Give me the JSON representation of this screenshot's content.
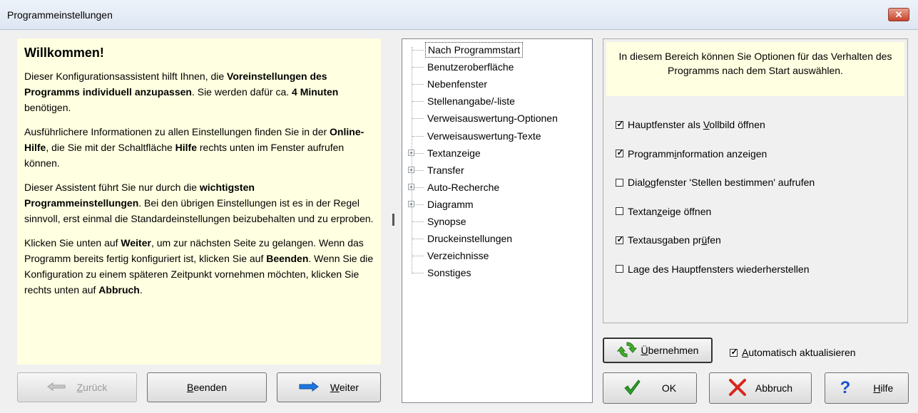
{
  "window": {
    "title": "Programmeinstellungen",
    "close_label": "✕"
  },
  "welcome": {
    "heading": "Willkommen!",
    "p1": [
      {
        "text": "Dieser Konfigurationsassistent hilft Ihnen, die ",
        "bold": false
      },
      {
        "text": "Voreinstellungen des Programms individuell anzupassen",
        "bold": true
      },
      {
        "text": ". Sie werden dafür ca. ",
        "bold": false
      },
      {
        "text": "4 Minuten",
        "bold": true
      },
      {
        "text": " benötigen.",
        "bold": false
      }
    ],
    "p2": [
      {
        "text": "Ausführlichere Informationen zu allen Einstellungen finden Sie in der ",
        "bold": false
      },
      {
        "text": "Online-Hilfe",
        "bold": true
      },
      {
        "text": ", die Sie mit der Schaltfläche ",
        "bold": false
      },
      {
        "text": "Hilfe",
        "bold": true
      },
      {
        "text": " rechts unten im Fenster aufrufen können.",
        "bold": false
      }
    ],
    "p3": [
      {
        "text": "Dieser Assistent führt Sie nur durch die ",
        "bold": false
      },
      {
        "text": "wichtigsten Programmeinstellungen",
        "bold": true
      },
      {
        "text": ". Bei den übrigen Einstellungen ist es in der Regel sinnvoll, erst einmal die Standardeinstellungen beizubehalten und zu erproben.",
        "bold": false
      }
    ],
    "p4": [
      {
        "text": "Klicken Sie unten auf ",
        "bold": false
      },
      {
        "text": "Weiter",
        "bold": true
      },
      {
        "text": ", um zur nächsten Seite zu gelangen. Wenn das Programm bereits fertig konfiguriert ist, klicken Sie auf ",
        "bold": false
      },
      {
        "text": "Beenden",
        "bold": true
      },
      {
        "text": ". Wenn Sie die Konfiguration zu einem späteren Zeitpunkt vornehmen möchten, klicken Sie rechts unten auf ",
        "bold": false
      },
      {
        "text": "Abbruch",
        "bold": true
      },
      {
        "text": ".",
        "bold": false
      }
    ]
  },
  "nav_buttons": {
    "back": {
      "label": "Zurück",
      "mnemonic": "Z",
      "rest": "urück",
      "enabled": false
    },
    "finish": {
      "label": "Beenden",
      "mnemonic": "B",
      "rest": "eenden"
    },
    "next": {
      "label": "Weiter",
      "mnemonic": "W",
      "rest": "eiter"
    }
  },
  "tree": {
    "items": [
      {
        "label": "Nach Programmstart",
        "selected": true,
        "expandable": false
      },
      {
        "label": "Benutzeroberfläche",
        "selected": false,
        "expandable": false
      },
      {
        "label": "Nebenfenster",
        "selected": false,
        "expandable": false
      },
      {
        "label": "Stellenangabe/-liste",
        "selected": false,
        "expandable": false
      },
      {
        "label": "Verweisauswertung-Optionen",
        "selected": false,
        "expandable": false
      },
      {
        "label": "Verweisauswertung-Texte",
        "selected": false,
        "expandable": false
      },
      {
        "label": "Textanzeige",
        "selected": false,
        "expandable": true
      },
      {
        "label": "Transfer",
        "selected": false,
        "expandable": true
      },
      {
        "label": "Auto-Recherche",
        "selected": false,
        "expandable": true
      },
      {
        "label": "Diagramm",
        "selected": false,
        "expandable": true
      },
      {
        "label": "Synopse",
        "selected": false,
        "expandable": false
      },
      {
        "label": "Druckeinstellungen",
        "selected": false,
        "expandable": false
      },
      {
        "label": "Verzeichnisse",
        "selected": false,
        "expandable": false
      },
      {
        "label": "Sonstiges",
        "selected": false,
        "expandable": false
      }
    ]
  },
  "options": {
    "info": "In diesem Bereich können Sie Optionen für das Verhalten des Programms nach dem Start auswählen.",
    "checkboxes": [
      {
        "pre": "Hauptfenster als ",
        "u": "V",
        "post": "ollbild öffnen",
        "checked": true
      },
      {
        "pre": "Programm",
        "u": "i",
        "post": "nformation anzeigen",
        "checked": true
      },
      {
        "pre": "Dial",
        "u": "o",
        "post": "gfenster 'Stellen bestimmen' aufrufen",
        "checked": false
      },
      {
        "pre": "Textan",
        "u": "z",
        "post": "eige öffnen",
        "checked": false
      },
      {
        "pre": "Textausgaben pr",
        "u": "ü",
        "post": "fen",
        "checked": true
      },
      {
        "pre": "Lage des Hauptfensters wiederherstellen",
        "u": "",
        "post": "",
        "checked": false
      }
    ]
  },
  "apply": {
    "label": "Übernehmen",
    "mnemonic": "Ü",
    "rest": "bernehmen"
  },
  "auto_update": {
    "pre": "",
    "u": "A",
    "post": "utomatisch aktualisieren",
    "checked": true
  },
  "dialog_buttons": {
    "ok": "OK",
    "cancel": "Abbruch",
    "help": {
      "label": "Hilfe",
      "mnemonic": "H",
      "rest": "ilfe"
    }
  },
  "colors": {
    "info_bg": "#ffffe1",
    "check_green": "#2e9d2a",
    "cancel_red": "#d9261c",
    "help_blue": "#1a4fd6",
    "arrow_blue": "#1e78e0"
  },
  "icons": {
    "back": "left-arrow-icon",
    "next": "right-arrow-icon",
    "apply": "refresh-icon",
    "ok": "checkmark-icon",
    "cancel": "x-icon",
    "help": "question-mark-icon"
  }
}
